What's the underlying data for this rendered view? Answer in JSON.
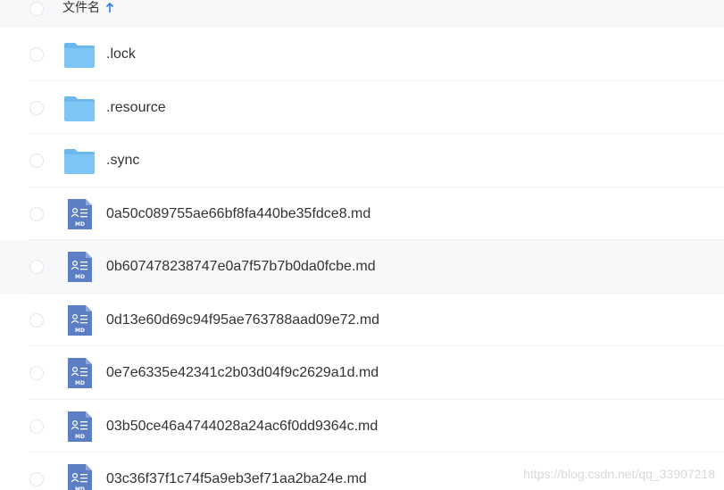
{
  "header": {
    "column_label": "文件名",
    "sort_icon": "arrow-up-icon",
    "accent_color": "#2b7de9"
  },
  "rows": [
    {
      "name": ".lock",
      "type": "folder",
      "icon": "folder-icon"
    },
    {
      "name": ".resource",
      "type": "folder",
      "icon": "folder-icon"
    },
    {
      "name": ".sync",
      "type": "folder",
      "icon": "folder-icon"
    },
    {
      "name": "0a50c089755ae66bf8fa440be35fdce8.md",
      "type": "markdown",
      "icon": "markdown-file-icon"
    },
    {
      "name": "0b607478238747e0a7f57b7b0da0fcbe.md",
      "type": "markdown",
      "icon": "markdown-file-icon",
      "hovered": true
    },
    {
      "name": "0d13e60d69c94f95ae763788aad09e72.md",
      "type": "markdown",
      "icon": "markdown-file-icon"
    },
    {
      "name": "0e7e6335e42341c2b03d04f9c2629a1d.md",
      "type": "markdown",
      "icon": "markdown-file-icon"
    },
    {
      "name": "03b50ce46a4744028a24ac6f0dd9364c.md",
      "type": "markdown",
      "icon": "markdown-file-icon"
    },
    {
      "name": "03c36f37f1c74f5a9eb3ef71aa2ba24e.md",
      "type": "markdown",
      "icon": "markdown-file-icon"
    }
  ],
  "colors": {
    "folder": "#7cc5f5",
    "folder_tab": "#6ab8ee",
    "markdown_file": "#5b7ec4"
  },
  "watermark": "https://blog.csdn.net/qq_33907218"
}
